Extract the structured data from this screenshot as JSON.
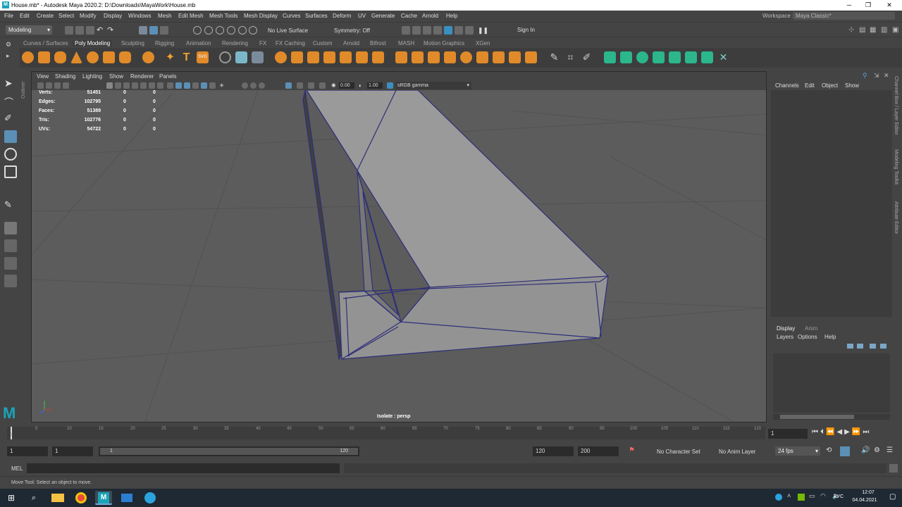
{
  "window": {
    "title": "House.mb* - Autodesk Maya 2020.2: D:\\Downloads\\MayaWork\\House.mb",
    "logo": "M"
  },
  "menubar": [
    "File",
    "Edit",
    "Create",
    "Select",
    "Modify",
    "Display",
    "Windows",
    "Mesh",
    "Edit Mesh",
    "Mesh Tools",
    "Mesh Display",
    "Curves",
    "Surfaces",
    "Deform",
    "UV",
    "Generate",
    "Cache",
    "Arnold",
    "Help"
  ],
  "workspace": {
    "label": "Workspace :",
    "value": "Maya Classic*"
  },
  "statusline": {
    "mode": "Modeling",
    "live_surface": "No Live Surface",
    "symmetry": "Symmetry: Off",
    "sign_in": "Sign In"
  },
  "shelf_tabs": [
    "Curves / Surfaces",
    "Poly Modeling",
    "Sculpting",
    "Rigging",
    "Animation",
    "Rendering",
    "FX",
    "FX Caching",
    "Custom",
    "Arnold",
    "Bifrost",
    "MASH",
    "Motion Graphics",
    "XGen"
  ],
  "shelf_active": "Poly Modeling",
  "outliner_tab": "Outliner",
  "panel_menu": [
    "View",
    "Shading",
    "Lighting",
    "Show",
    "Renderer",
    "Panels"
  ],
  "panel_tools": {
    "exposure": "0.00",
    "gamma": "1.00",
    "colorspace": "sRGB gamma"
  },
  "hud_stats": [
    {
      "label": "Verts:",
      "value": "51451",
      "c2": "0",
      "c3": "0"
    },
    {
      "label": "Edges:",
      "value": "102795",
      "c2": "0",
      "c3": "0"
    },
    {
      "label": "Faces:",
      "value": "51389",
      "c2": "0",
      "c3": "0"
    },
    {
      "label": "Tris:",
      "value": "102776",
      "c2": "0",
      "c3": "0"
    },
    {
      "label": "UVs:",
      "value": "54722",
      "c2": "0",
      "c3": "0"
    }
  ],
  "camera_label": "Isolate : persp",
  "channelbox_menu": [
    "Channels",
    "Edit",
    "Object",
    "Show"
  ],
  "side_tabs": [
    "Channel Box / Layer Editor",
    "Modeling Toolkit",
    "Attribute Editor"
  ],
  "layers": {
    "tabs": [
      "Display",
      "Anim"
    ],
    "menu": [
      "Layers",
      "Options",
      "Help"
    ]
  },
  "timeline": {
    "ticks": [
      "5",
      "10",
      "15",
      "20",
      "25",
      "30",
      "35",
      "40",
      "45",
      "50",
      "55",
      "60",
      "65",
      "70",
      "75",
      "80",
      "85",
      "90",
      "95",
      "100",
      "105",
      "110",
      "115",
      "120"
    ],
    "start_marker": "1",
    "current_frame": "1"
  },
  "range": {
    "start": "1",
    "inner_start": "1",
    "slider_start": "1",
    "slider_end": "120",
    "end": "120",
    "max": "200",
    "character_set": "No Character Set",
    "anim_layer": "No Anim Layer",
    "fps": "24 fps"
  },
  "mel_label": "MEL",
  "help_text": "Move Tool: Select an object to move.",
  "taskbar": {
    "lang": "РУС",
    "time": "12:07",
    "date": "04.04.2021"
  }
}
